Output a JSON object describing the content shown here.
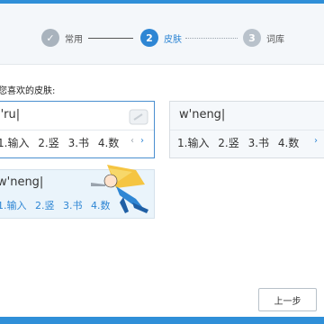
{
  "steps": [
    {
      "number": "✓",
      "label": "常用",
      "state": "done"
    },
    {
      "number": "2",
      "label": "皮肤",
      "state": "active"
    },
    {
      "number": "3",
      "label": "词库",
      "state": "todo"
    }
  ],
  "section_title": "您喜欢的皮肤:",
  "skins": [
    {
      "pinyin": "l'ru|",
      "candidates": [
        "1.输入",
        "2.竖",
        "3.书",
        "4.数"
      ]
    },
    {
      "pinyin": "w'neng|",
      "candidates": [
        "1.输入",
        "2.竖",
        "3.书",
        "4.数"
      ]
    },
    {
      "pinyin": "w'neng|",
      "candidates": [
        "1.输入",
        "2.竖",
        "3.书",
        "4.数"
      ]
    }
  ],
  "nav": {
    "prev": "‹",
    "next": "›"
  },
  "buttons": {
    "back": "上一步"
  },
  "colors": {
    "accent": "#2e86d4",
    "strip": "#2f8fd8"
  }
}
